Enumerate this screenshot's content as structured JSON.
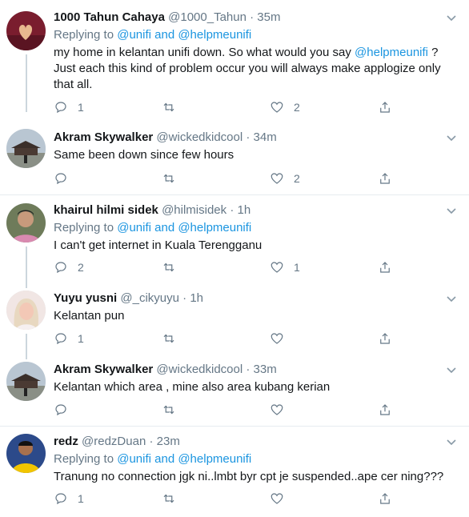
{
  "tweets": [
    {
      "name": "1000 Tahun Cahaya",
      "handle": "@1000_Tahun",
      "sep": "·",
      "time": "35m",
      "replying_prefix": "Replying to",
      "replying_to": "@unifi and @helpmeunifi",
      "text_before": "my home in kelantan unifi down. So what would you say ",
      "text_mention": "@helpmeunifi",
      "text_after": " ? Just each this kind of problem occur you will always make applogize only that all.",
      "reply_count": "1",
      "retweet_count": "",
      "like_count": "2",
      "avatar_icon": "heart-hands-avatar"
    },
    {
      "name": "Akram Skywalker",
      "handle": "@wickedkidcool",
      "sep": "·",
      "time": "34m",
      "text": "Same been down since few hours",
      "reply_count": "",
      "retweet_count": "",
      "like_count": "2",
      "avatar_icon": "palace-avatar"
    },
    {
      "name": "khairul hilmi sidek",
      "handle": "@hilmisidek",
      "sep": "·",
      "time": "1h",
      "replying_prefix": "Replying to",
      "replying_to": "@unifi and @helpmeunifi",
      "text": "I can't get internet in Kuala Terengganu",
      "reply_count": "2",
      "retweet_count": "",
      "like_count": "1",
      "avatar_icon": "person-avatar"
    },
    {
      "name": "Yuyu yusni",
      "handle": "@_cikyuyu",
      "sep": "·",
      "time": "1h",
      "text": "Kelantan pun",
      "reply_count": "1",
      "retweet_count": "",
      "like_count": "",
      "avatar_icon": "woman-avatar"
    },
    {
      "name": "Akram Skywalker",
      "handle": "@wickedkidcool",
      "sep": "·",
      "time": "33m",
      "text": "Kelantan which area , mine also area kubang kerian",
      "reply_count": "",
      "retweet_count": "",
      "like_count": "",
      "avatar_icon": "palace-avatar"
    },
    {
      "name": "redz",
      "handle": "@redzDuan",
      "sep": "·",
      "time": "23m",
      "replying_prefix": "Replying to",
      "replying_to": "@unifi and @helpmeunifi",
      "text": "Tranung no connection jgk ni..lmbt byr cpt je suspended..ape cer ning???",
      "reply_count": "1",
      "retweet_count": "",
      "like_count": "",
      "avatar_icon": "man-yellow-avatar"
    }
  ],
  "colors": {
    "link": "#1b95e0",
    "muted": "#657786",
    "divider": "#e6ecf0",
    "thread_line": "#ccd6dd"
  }
}
